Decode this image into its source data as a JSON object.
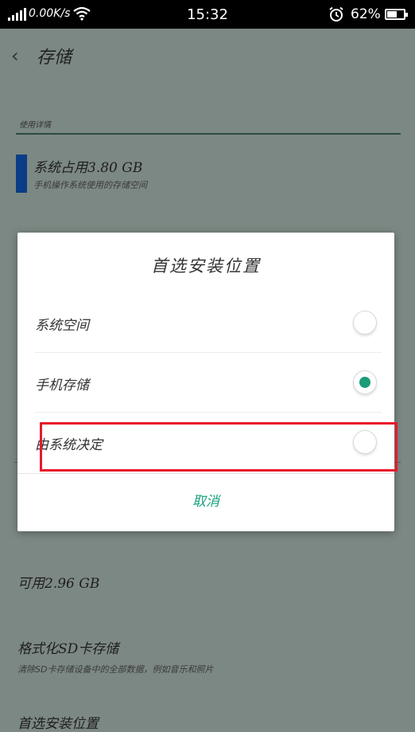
{
  "status_bar": {
    "net_speed": "0.00K/s",
    "time": "15:32",
    "battery_percent": "62%",
    "battery_level": 0.62,
    "icons": [
      "signal-icon",
      "wifi-icon",
      "alarm-icon",
      "battery-icon"
    ]
  },
  "header": {
    "back_icon": "chevron-left-icon",
    "title": "存储"
  },
  "usage": {
    "section_label": "使用详情",
    "system_title": "系统占用3.80 GB",
    "system_sub": "手机操作系统使用的存储空间",
    "bar_color": "#0b3d87"
  },
  "background_items": {
    "available": "可用2.96 GB",
    "format_title": "格式化SD卡存储",
    "format_sub": "清除SD卡存储设备中的全部数据，例如音乐和照片",
    "preferred_title": "首选安装位置"
  },
  "dialog": {
    "title": "首选安装位置",
    "options": [
      {
        "label": "系统空间",
        "selected": false
      },
      {
        "label": "手机存储",
        "selected": true
      },
      {
        "label": "由系统决定",
        "selected": false
      }
    ],
    "cancel_label": "取消",
    "accent_color": "#18a27e"
  },
  "annotation": {
    "highlight_color": "#e8192b"
  }
}
